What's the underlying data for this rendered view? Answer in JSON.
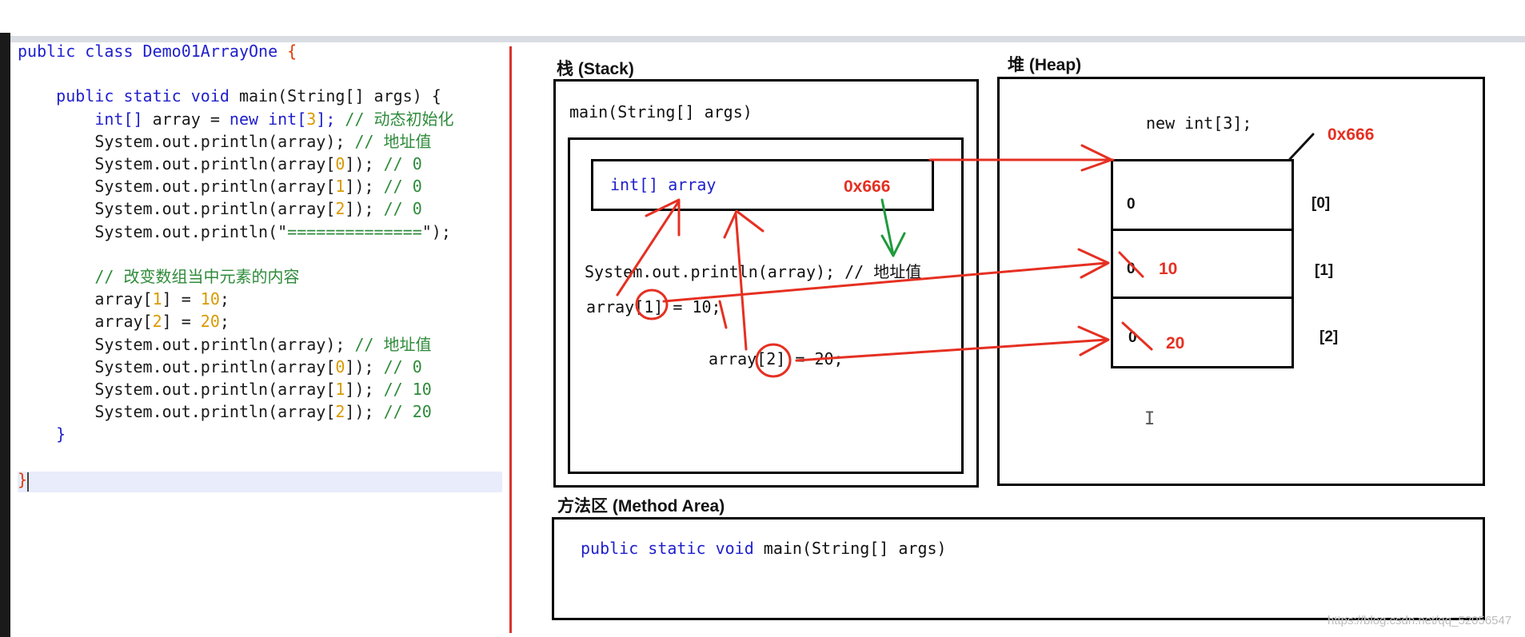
{
  "code": {
    "lines": [
      {
        "parts": [
          {
            "t": "public class Demo01ArrayOne ",
            "c": "kw"
          },
          {
            "t": "{",
            "c": "br"
          }
        ]
      },
      {
        "parts": []
      },
      {
        "parts": [
          {
            "t": "    public static void ",
            "c": "kw"
          },
          {
            "t": "main(String[] args) {",
            "c": ""
          }
        ]
      },
      {
        "parts": [
          {
            "t": "        int[] ",
            "c": "kw"
          },
          {
            "t": "array = ",
            "c": ""
          },
          {
            "t": "new int[",
            "c": "kw"
          },
          {
            "t": "3",
            "c": "num"
          },
          {
            "t": "]; ",
            "c": "kw"
          },
          {
            "t": "// 动态初始化",
            "c": "cm"
          }
        ]
      },
      {
        "parts": [
          {
            "t": "        System.out.println(array); ",
            "c": ""
          },
          {
            "t": "// 地址值",
            "c": "cm"
          }
        ]
      },
      {
        "parts": [
          {
            "t": "        System.out.println(array[",
            "c": ""
          },
          {
            "t": "0",
            "c": "num"
          },
          {
            "t": "]); ",
            "c": ""
          },
          {
            "t": "// 0",
            "c": "cm"
          }
        ]
      },
      {
        "parts": [
          {
            "t": "        System.out.println(array[",
            "c": ""
          },
          {
            "t": "1",
            "c": "num"
          },
          {
            "t": "]); ",
            "c": ""
          },
          {
            "t": "// 0",
            "c": "cm"
          }
        ]
      },
      {
        "parts": [
          {
            "t": "        System.out.println(array[",
            "c": ""
          },
          {
            "t": "2",
            "c": "num"
          },
          {
            "t": "]); ",
            "c": ""
          },
          {
            "t": "// 0",
            "c": "cm"
          }
        ]
      },
      {
        "parts": [
          {
            "t": "        System.out.println(\"",
            "c": ""
          },
          {
            "t": "==============",
            "c": "cm"
          },
          {
            "t": "\");",
            "c": ""
          }
        ]
      },
      {
        "parts": []
      },
      {
        "parts": [
          {
            "t": "        // 改变数组当中元素的内容",
            "c": "cm"
          }
        ]
      },
      {
        "parts": [
          {
            "t": "        array[",
            "c": ""
          },
          {
            "t": "1",
            "c": "num"
          },
          {
            "t": "] = ",
            "c": ""
          },
          {
            "t": "10",
            "c": "num"
          },
          {
            "t": ";",
            "c": ""
          }
        ]
      },
      {
        "parts": [
          {
            "t": "        array[",
            "c": ""
          },
          {
            "t": "2",
            "c": "num"
          },
          {
            "t": "] = ",
            "c": ""
          },
          {
            "t": "20",
            "c": "num"
          },
          {
            "t": ";",
            "c": ""
          }
        ]
      },
      {
        "parts": [
          {
            "t": "        System.out.println(array); ",
            "c": ""
          },
          {
            "t": "// 地址值",
            "c": "cm"
          }
        ]
      },
      {
        "parts": [
          {
            "t": "        System.out.println(array[",
            "c": ""
          },
          {
            "t": "0",
            "c": "num"
          },
          {
            "t": "]); ",
            "c": ""
          },
          {
            "t": "// 0",
            "c": "cm"
          }
        ]
      },
      {
        "parts": [
          {
            "t": "        System.out.println(array[",
            "c": ""
          },
          {
            "t": "1",
            "c": "num"
          },
          {
            "t": "]); ",
            "c": ""
          },
          {
            "t": "// 10",
            "c": "cm"
          }
        ]
      },
      {
        "parts": [
          {
            "t": "        System.out.println(array[",
            "c": ""
          },
          {
            "t": "2",
            "c": "num"
          },
          {
            "t": "]); ",
            "c": ""
          },
          {
            "t": "// 20",
            "c": "cm"
          }
        ]
      },
      {
        "parts": [
          {
            "t": "    }",
            "c": "kw"
          }
        ]
      },
      {
        "parts": []
      },
      {
        "parts": [
          {
            "t": "}",
            "c": "br"
          }
        ]
      }
    ]
  },
  "stack": {
    "title": "栈 (Stack)",
    "frame_label": "main(String[] args)",
    "var_decl": "int[] array",
    "var_value": "0x666",
    "println_line": "System.out.println(array); // 地址值",
    "assign1": "array[1] = 10;",
    "assign2": "array[2] = 20;"
  },
  "heap": {
    "title": "堆 (Heap)",
    "new_expr": "new int[3];",
    "address": "0x666",
    "cells": [
      {
        "old": "0",
        "new": "",
        "index": "[0]"
      },
      {
        "old": "0",
        "new": "10",
        "index": "[1]"
      },
      {
        "old": "0",
        "new": "20",
        "index": "[2]"
      }
    ]
  },
  "method_area": {
    "title": "方法区 (Method Area)",
    "signature": "public static void main(String[] args)"
  },
  "watermark": "https://blog.csdn.net/qq_52056547",
  "colors": {
    "annotation_red": "#e53022",
    "annotation_green": "#1e9a3c",
    "keyword_blue": "#1f1fcc"
  }
}
